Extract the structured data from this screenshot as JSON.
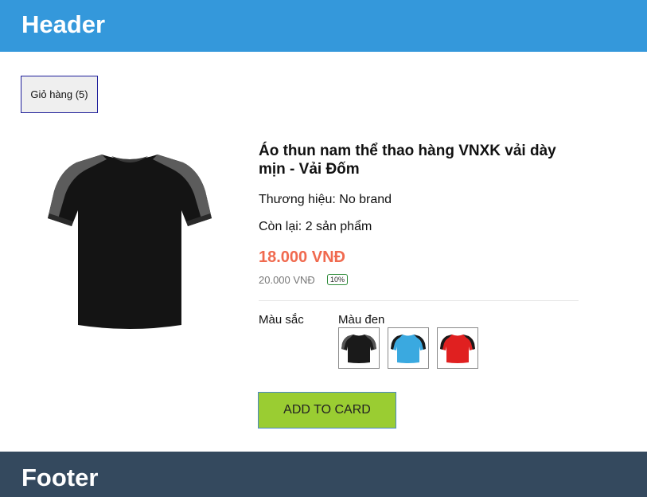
{
  "header": {
    "title": "Header"
  },
  "cart": {
    "label": "Giỏ hàng (5)"
  },
  "product": {
    "name": "Áo thun nam thể thao hàng VNXK vải dày mịn - Vải Đốm",
    "brand_label": "Thương hiệu: No brand",
    "stock_label": "Còn lại: 2 sản phẩm",
    "price": "18.000 VNĐ",
    "old_price": "20.000 VNĐ",
    "discount": "10%",
    "color_label": "Màu sắc",
    "selected_color": "Màu đen",
    "swatches": [
      {
        "name": "black",
        "body": "#1a1a1a",
        "accent": "#555555"
      },
      {
        "name": "blue",
        "body": "#3aa9e0",
        "accent": "#1a1a1a"
      },
      {
        "name": "red",
        "body": "#e02020",
        "accent": "#1a1a1a"
      }
    ],
    "add_button": "ADD TO CARD"
  },
  "footer": {
    "title": "Footer"
  },
  "colors": {
    "header_bg": "#3498db",
    "footer_bg": "#34495e",
    "price": "#f06a4f",
    "add_button_bg": "#9acd32"
  }
}
